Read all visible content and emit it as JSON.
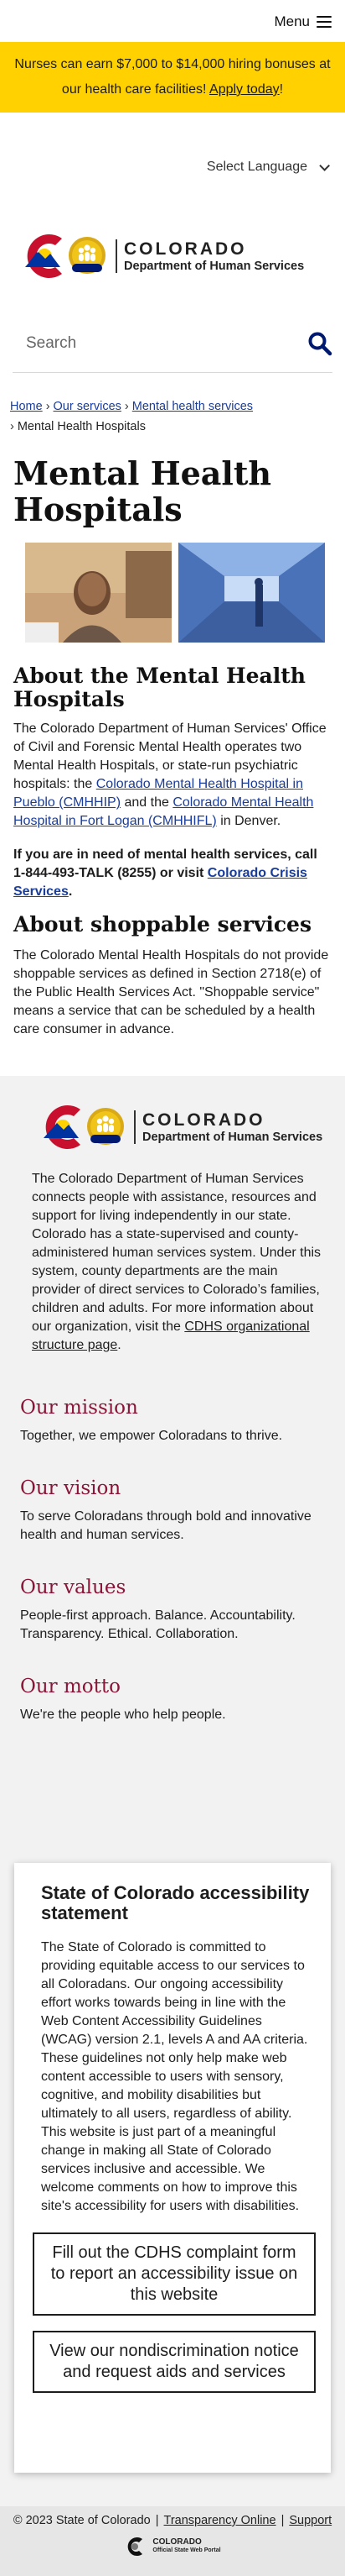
{
  "header": {
    "menu_label": "Menu"
  },
  "banner": {
    "text": "Nurses can earn $7,000 to $14,000 hiring bonuses at our health care facilities! ",
    "link": "Apply today",
    "after": "!"
  },
  "language": {
    "label": "Select Language"
  },
  "logo": {
    "state": "COLORADO",
    "dept": "Department of Human Services",
    "badge": "CDHS"
  },
  "search": {
    "placeholder": "Search"
  },
  "breadcrumb": {
    "home": "Home",
    "services": "Our services",
    "mental": "Mental health services",
    "current": "Mental Health Hospitals",
    "sep": "›"
  },
  "page": {
    "title": "Mental Health Hospitals",
    "about_heading": "About the Mental Health Hospitals",
    "about_text_1": "The Colorado Department of Human Services' Office of Civil and Forensic Mental Health operates two Mental Health Hospitals, or state-run psychiatric hospitals: the ",
    "about_link_1": "Colorado Mental Health Hospital in Pueblo (CMHHIP)",
    "about_text_2": " and the ",
    "about_link_2": "Colorado Mental Health Hospital in Fort Logan (CMHHIFL)",
    "about_text_3": " in Denver.",
    "call_text": "If you are in need of mental health services, call 1-844-493-TALK (8255) or visit ",
    "call_link": "Colorado Crisis Services",
    "call_after": ".",
    "shop_heading": "About shoppable services",
    "shop_text": "The Colorado Mental Health Hospitals do not provide shoppable services as defined in Section 2718(e) of the Public Health Services Act. \"Shoppable service\" means a service that can be scheduled by a health care consumer in advance."
  },
  "org": {
    "desc": "The Colorado Department of Human Services connects people with assistance, resources and support for living independently in our state. Colorado has a state-supervised and county-administered human services system. Under this system, county departments are the main provider of direct services to Colorado’s families, children and adults. For more information about our organization, visit the ",
    "desc_link": "CDHS organizational structure page",
    "desc_after": ".",
    "mission_heading": "Our mission",
    "mission_text": "Together, we empower Coloradans to thrive.",
    "vision_heading": "Our vision",
    "vision_text": "To serve Coloradans through bold and innovative health and human services.",
    "values_heading": "Our values",
    "values_text": "People-first approach. Balance. Accountability. Transparency. Ethical. Collaboration.",
    "motto_heading": "Our motto",
    "motto_text": "We're the people who help people."
  },
  "accessibility": {
    "heading": "State of Colorado accessibility statement",
    "text": "The State of Colorado is committed to providing equitable access to our services to all Coloradans. Our ongoing accessibility effort works towards being in line with the Web Content Accessibility Guidelines (WCAG) version 2.1, levels A and AA criteria. These guidelines not only help make web content accessible to users with sensory, cognitive, and mobility disabilities but ultimately to all users, regardless of ability. This website is just part of a meaningful change in making all State of Colorado services inclusive and accessible. We welcome comments on how to improve this site's accessibility for users with disabilities.",
    "button1": "Fill out the CDHS complaint form to report an accessibility issue on this website",
    "button2": "View our nondiscrimination notice and request aids and services"
  },
  "footer": {
    "copyright": "© 2023 State of Colorado",
    "transparency": "Transparency Online",
    "support": "Support",
    "portal_line1": "COLORADO",
    "portal_line2": "Official State Web Portal"
  },
  "colors": {
    "banner": "#FFD100",
    "accent_navy": "#001970",
    "heading_maroon": "#8a1538"
  }
}
